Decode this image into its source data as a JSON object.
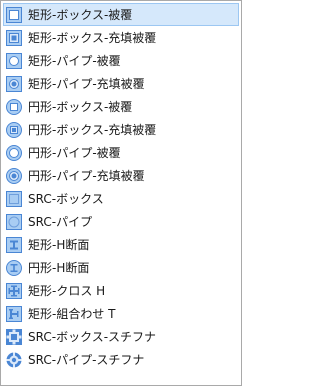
{
  "menu": {
    "items": [
      {
        "label": "矩形-ボックス-被覆",
        "icon": "rect-box-coated-icon"
      },
      {
        "label": "矩形-ボックス-充填被覆",
        "icon": "rect-box-filled-coated-icon"
      },
      {
        "label": "矩形-パイプ-被覆",
        "icon": "rect-pipe-coated-icon"
      },
      {
        "label": "矩形-パイプ-充填被覆",
        "icon": "rect-pipe-filled-coated-icon"
      },
      {
        "label": "円形-ボックス-被覆",
        "icon": "circle-box-coated-icon"
      },
      {
        "label": "円形-ボックス-充填被覆",
        "icon": "circle-box-filled-coated-icon"
      },
      {
        "label": "円形-パイプ-被覆",
        "icon": "circle-pipe-coated-icon"
      },
      {
        "label": "円形-パイプ-充填被覆",
        "icon": "circle-pipe-filled-coated-icon"
      },
      {
        "label": "SRC-ボックス",
        "icon": "src-box-icon"
      },
      {
        "label": "SRC-パイプ",
        "icon": "src-pipe-icon"
      },
      {
        "label": "矩形-H断面",
        "icon": "rect-h-section-icon"
      },
      {
        "label": "円形-H断面",
        "icon": "circle-h-section-icon"
      },
      {
        "label": "矩形-クロス H",
        "icon": "rect-cross-h-icon"
      },
      {
        "label": "矩形-組合わせ T",
        "icon": "rect-combined-t-icon"
      },
      {
        "label": "SRC-ボックス-スチフナ",
        "icon": "src-box-stiffener-icon"
      },
      {
        "label": "SRC-パイプ-スチフナ",
        "icon": "src-pipe-stiffener-icon"
      }
    ]
  },
  "colors": {
    "highlight_bg": "#d5e8fb",
    "highlight_border": "#9cc7f2",
    "icon_blue": "#4a86d4",
    "icon_light_blue": "#a9cdf3",
    "icon_pale_blue": "#dbe9fa"
  }
}
